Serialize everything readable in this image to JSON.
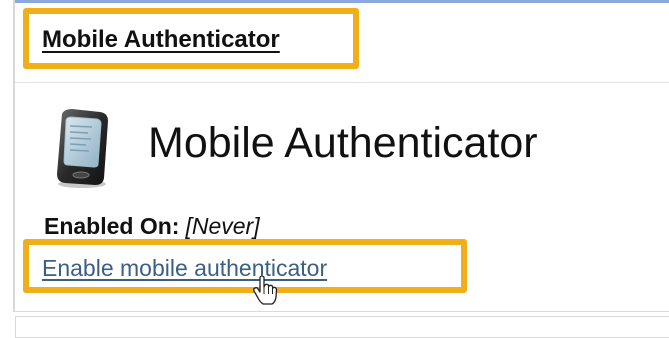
{
  "section": {
    "header_title": "Mobile Authenticator"
  },
  "main": {
    "title": "Mobile Authenticator",
    "icon": "mobile-phone-icon",
    "enabled_label": "Enabled On:",
    "enabled_value": "[Never]",
    "enable_link_label": "Enable mobile authenticator"
  },
  "cursor": {
    "icon": "hand-pointer-icon"
  },
  "colors": {
    "highlight": "#f0ae1b",
    "link": "#3b5f86",
    "top_strip": "#8aa8e0"
  }
}
